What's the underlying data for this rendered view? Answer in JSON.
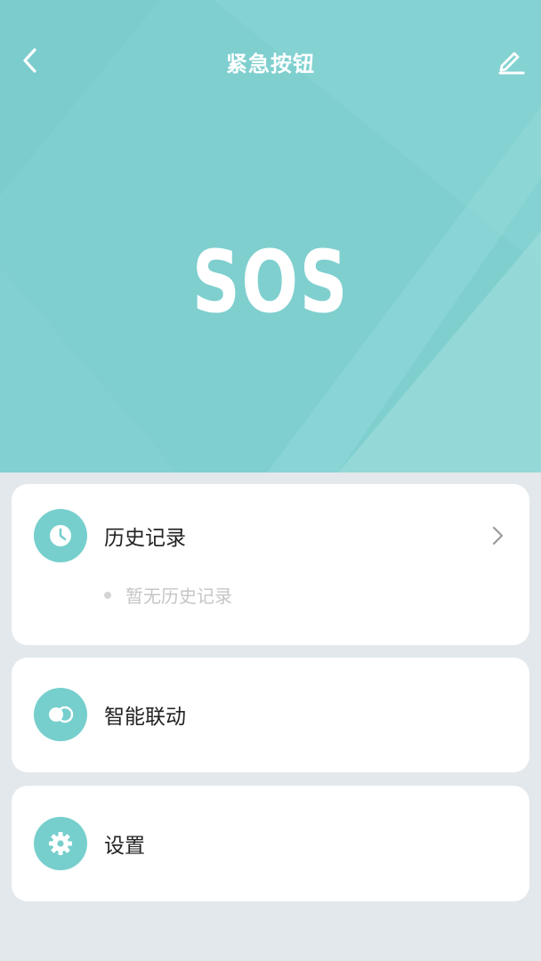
{
  "header": {
    "title": "紧急按钮",
    "back_icon": "chevron-left-icon",
    "edit_icon": "pencil-icon"
  },
  "hero": {
    "text": "SOS",
    "background_color": "#7fcfcf"
  },
  "cards": {
    "history": {
      "label": "历史记录",
      "icon": "clock-icon",
      "empty_text": "暂无历史记录"
    },
    "linkage": {
      "label": "智能联动",
      "icon": "toggle-icon"
    },
    "settings": {
      "label": "设置",
      "icon": "gear-icon"
    }
  },
  "colors": {
    "accent": "#76cfcd",
    "page_background": "#e2e8ec",
    "card_background": "#ffffff",
    "muted_text": "#c6c6c6"
  }
}
